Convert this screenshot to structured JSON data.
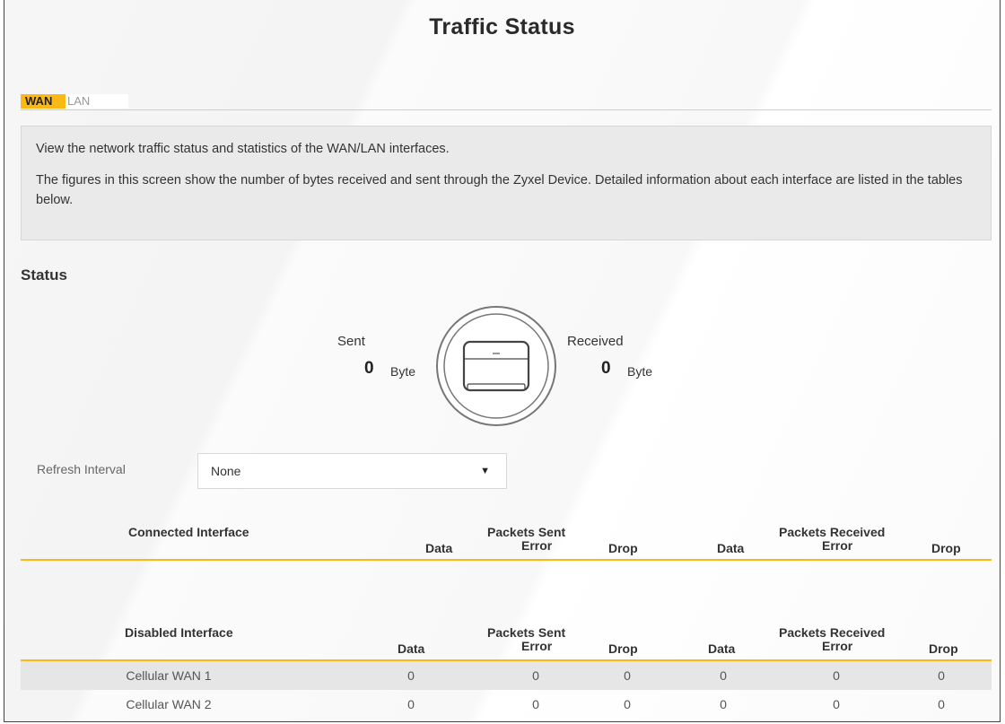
{
  "page": {
    "title": "Traffic Status"
  },
  "tabs": [
    {
      "label": "WAN",
      "active": true
    },
    {
      "label": "LAN",
      "active": false
    }
  ],
  "description": {
    "line1": "View the network traffic status and statistics of the WAN/LAN interfaces.",
    "line2": "The figures in this screen show the number of bytes received and sent through the Zyxel Device. Detailed information about each interface are listed in the tables below."
  },
  "status": {
    "section_title": "Status",
    "sent_label": "Sent",
    "sent_value": "0",
    "sent_unit": "Byte",
    "received_label": "Received",
    "received_value": "0",
    "received_unit": "Byte",
    "device_icon": "router-device-icon"
  },
  "refresh": {
    "label": "Refresh Interval",
    "selected": "None"
  },
  "connected_table": {
    "title": "Connected Interface",
    "group_sent": "Packets Sent",
    "group_received": "Packets Received",
    "col_data": "Data",
    "col_error": "Error",
    "col_drop": "Drop",
    "rows": []
  },
  "disabled_table": {
    "title": "Disabled Interface",
    "group_sent": "Packets Sent",
    "group_received": "Packets Received",
    "col_data": "Data",
    "col_error": "Error",
    "col_drop": "Drop",
    "rows": [
      {
        "name": "Cellular WAN 1",
        "sent_data": "0",
        "sent_error": "0",
        "sent_drop": "0",
        "recv_data": "0",
        "recv_error": "0",
        "recv_drop": "0"
      },
      {
        "name": "Cellular WAN 2",
        "sent_data": "0",
        "sent_error": "0",
        "sent_drop": "0",
        "recv_data": "0",
        "recv_error": "0",
        "recv_drop": "0"
      }
    ]
  },
  "colors": {
    "accent": "#fdb813",
    "panel": "#eaeaea",
    "row_shade": "#e6e6e6"
  }
}
